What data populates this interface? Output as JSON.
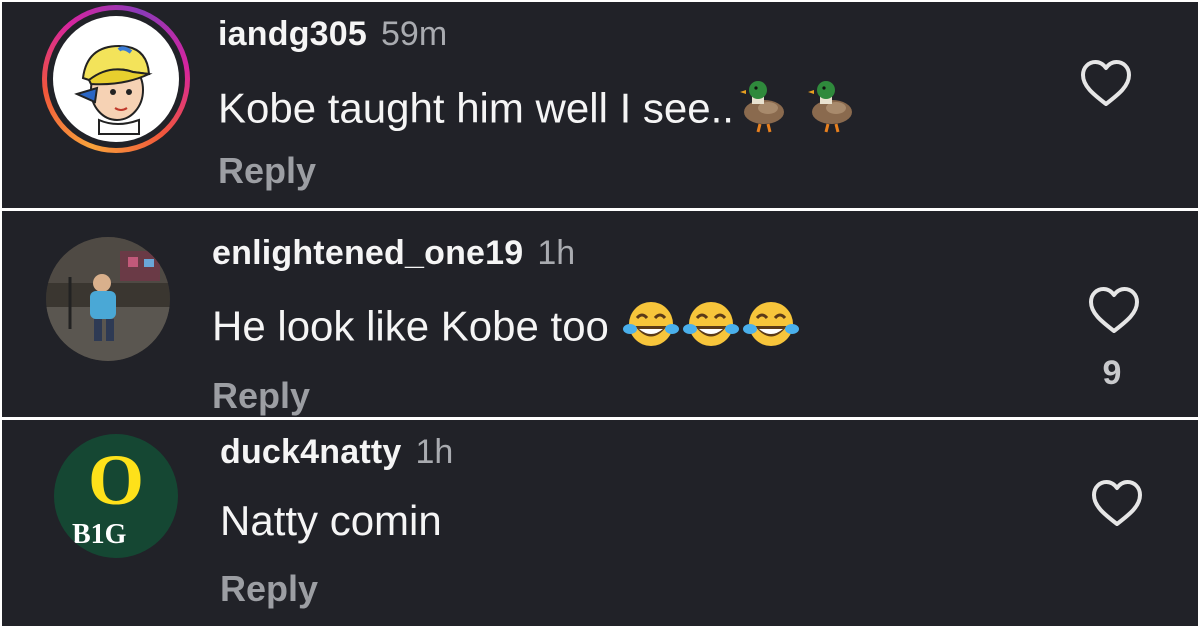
{
  "comments": [
    {
      "username": "iandg305",
      "time": "59m",
      "text": "Kobe taught him well I see..",
      "emojis": [
        "duck-emoji",
        "duck-emoji"
      ],
      "reply_label": "Reply",
      "avatar": "cartoon-kid-avatar",
      "story_ring": true
    },
    {
      "username": "enlightened_one19",
      "time": "1h",
      "text": "He look like Kobe too",
      "emojis": [
        "tears-of-joy-emoji",
        "tears-of-joy-emoji",
        "tears-of-joy-emoji"
      ],
      "reply_label": "Reply",
      "like_count": "9",
      "avatar": "photo-child-avatar"
    },
    {
      "username": "duck4natty",
      "time": "1h",
      "text": "Natty comin",
      "emojis": [],
      "reply_label": "Reply",
      "avatar": "oregon-big-ten-logo-avatar",
      "avatar_logo_text": "O",
      "avatar_badge_text": "B1G"
    }
  ],
  "colors": {
    "background": "#212228",
    "username": "#f5f5f5",
    "secondary": "#a9abb0",
    "reply": "#9c9ea3",
    "oregon_green": "#154733",
    "oregon_yellow": "#fee11a"
  },
  "icons": {
    "like": "heart-outline-icon"
  }
}
